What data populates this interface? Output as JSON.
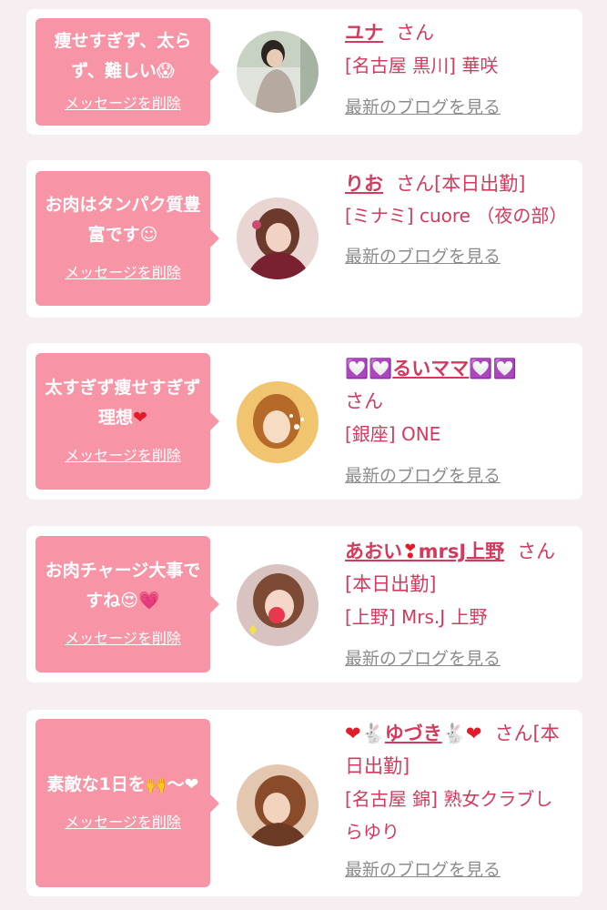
{
  "delete_label": "メッセージを削除",
  "blog_label": "最新のブログを見る",
  "san": "さん",
  "cards": [
    {
      "message": "痩せすぎず、太らず、難しい",
      "message_emoji": "😱",
      "name": "ユナ",
      "suffix": "さん",
      "shop": "[名古屋 黒川] 華咲"
    },
    {
      "message": "お肉はタンパク質豊富です",
      "message_emoji": "☺",
      "name": "りお",
      "suffix": "さん[本日出勤]",
      "shop": "[ミナミ] cuore （夜の部）"
    },
    {
      "message": "太すぎず痩せすぎず理想",
      "message_emoji": "❤",
      "name_prefix": "💟💟",
      "name": "るいママ",
      "name_suffix_icons": "💟💟",
      "suffix": "さん",
      "shop": "[銀座] ONE"
    },
    {
      "message": "お肉チャージ大事ですね",
      "message_emoji": "😍💗",
      "name": "あおい",
      "name_mid_icon": "❣",
      "name_tail": "mrsJ上野",
      "suffix": "さん[本日出勤]",
      "shop": "[上野] Mrs.J 上野"
    },
    {
      "message": "素敵な1日を",
      "message_emoji": "🙌〜❤",
      "name_prefix": "❤🐇",
      "name": "ゆづき",
      "name_suffix_icons": "🐇❤",
      "suffix": "さん[本日出勤]",
      "shop": "[名古屋 錦] 熟女クラブしらゆり"
    }
  ],
  "colors": {
    "background": "#f6eef0",
    "bubble": "#f795a6",
    "name_text": "#d23b5d",
    "link_gray": "#8c8c8c"
  }
}
